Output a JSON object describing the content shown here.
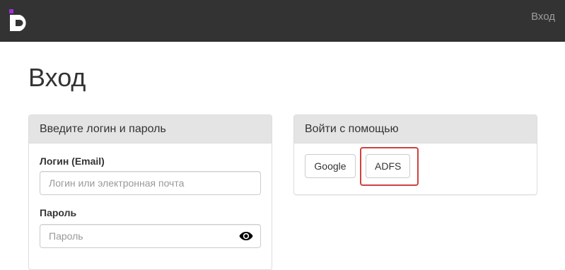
{
  "navbar": {
    "logo_icon": "brand-d-logo-icon",
    "brand_color": "#9b30d9",
    "login_link": "Вход"
  },
  "page": {
    "title": "Вход"
  },
  "credentials_panel": {
    "heading": "Введите логин и пароль",
    "login_label": "Логин (Email)",
    "login_placeholder": "Логин или электронная почта",
    "password_label": "Пароль",
    "password_placeholder": "Пароль",
    "password_toggle_icon": "eye-icon"
  },
  "external_panel": {
    "heading": "Войти с помощью",
    "buttons": [
      {
        "label": "Google"
      },
      {
        "label": "ADFS"
      }
    ],
    "highlight_color": "#d0413e"
  }
}
